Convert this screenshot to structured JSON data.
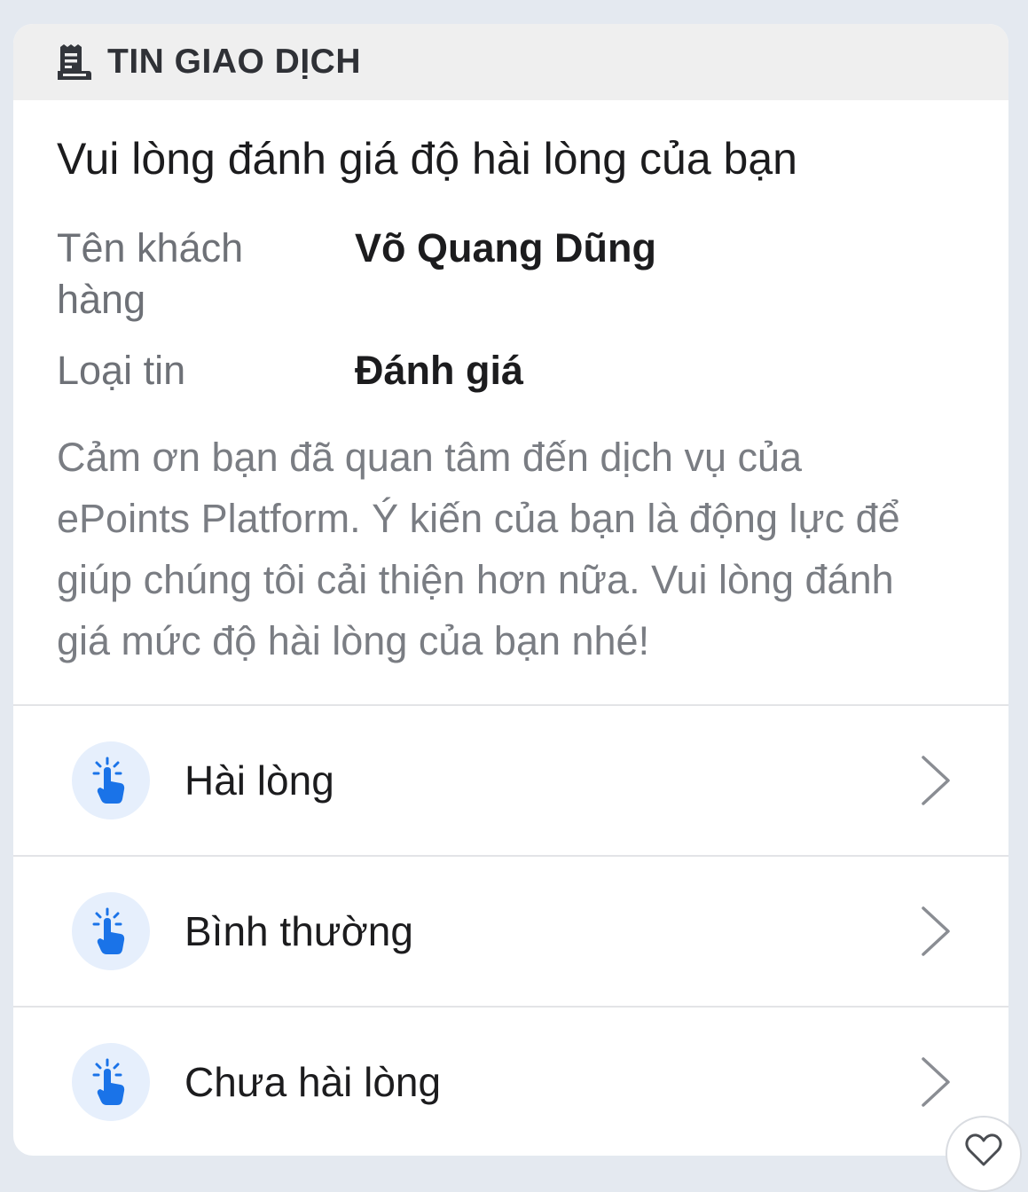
{
  "header": {
    "title": "TIN GIAO DỊCH",
    "icon": "receipt-icon"
  },
  "message": {
    "title": "Vui lòng đánh giá độ hài lòng của bạn",
    "fields": [
      {
        "label": "Tên khách hàng",
        "value": "Võ Quang Dũng"
      },
      {
        "label": "Loại tin",
        "value": "Đánh giá"
      }
    ],
    "description": "Cảm ơn bạn đã quan tâm đến dịch vụ của ePoints Platform. Ý kiến của bạn là động lực để giúp chúng tôi cải thiện hơn nữa. Vui lòng đánh giá mức độ hài lòng của bạn nhé!"
  },
  "options": [
    {
      "label": "Hài lòng",
      "icon": "tap-hand-icon"
    },
    {
      "label": "Bình thường",
      "icon": "tap-hand-icon"
    },
    {
      "label": "Chưa hài lòng",
      "icon": "tap-hand-icon"
    }
  ],
  "reaction": {
    "icon": "heart-icon"
  },
  "colors": {
    "accent": "#1a73e8",
    "icon_bg": "#e6effc",
    "header_bg": "#efefef"
  }
}
